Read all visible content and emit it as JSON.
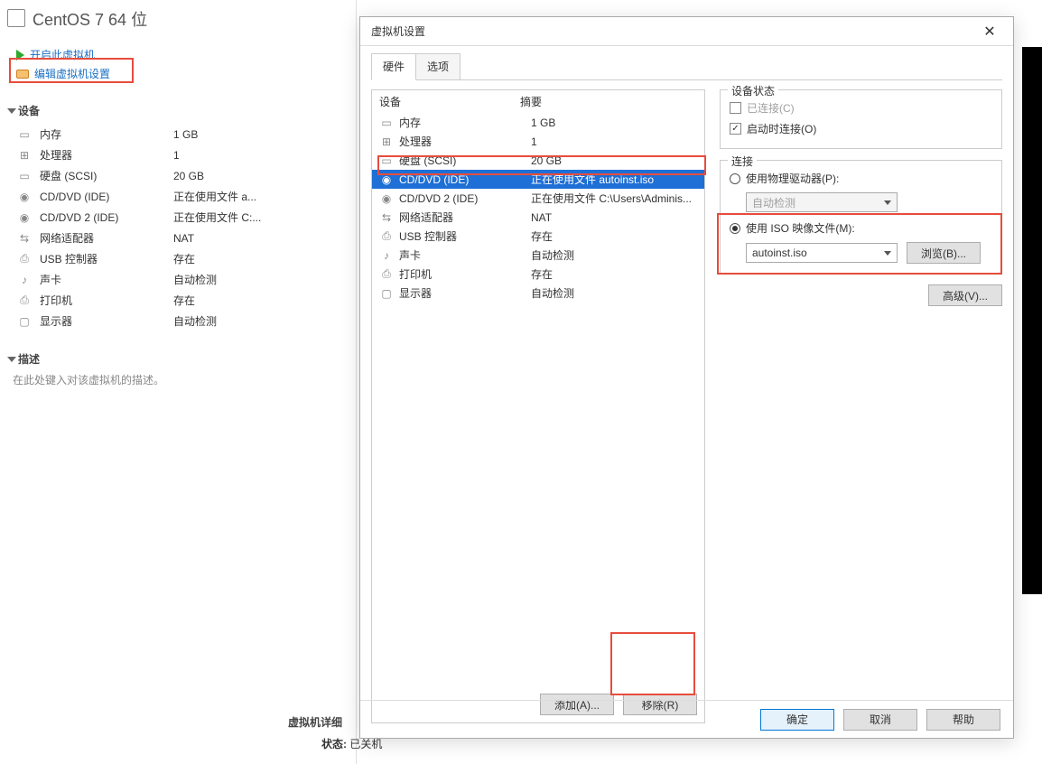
{
  "vm": {
    "title": "CentOS 7 64 位",
    "power_on": "开启此虚拟机",
    "edit_settings": "编辑虚拟机设置",
    "devices_hdr": "设备",
    "devices": [
      {
        "name": "内存",
        "value": "1 GB"
      },
      {
        "name": "处理器",
        "value": "1"
      },
      {
        "name": "硬盘 (SCSI)",
        "value": "20 GB"
      },
      {
        "name": "CD/DVD (IDE)",
        "value": "正在使用文件 a..."
      },
      {
        "name": "CD/DVD 2 (IDE)",
        "value": "正在使用文件 C:..."
      },
      {
        "name": "网络适配器",
        "value": "NAT"
      },
      {
        "name": "USB 控制器",
        "value": "存在"
      },
      {
        "name": "声卡",
        "value": "自动检测"
      },
      {
        "name": "打印机",
        "value": "存在"
      },
      {
        "name": "显示器",
        "value": "自动检测"
      }
    ],
    "desc_hdr": "描述",
    "desc_placeholder": "在此处键入对该虚拟机的描述。",
    "details_hdr": "虚拟机详细",
    "status_label": "状态:",
    "status_value": "已关机"
  },
  "dialog": {
    "title": "虚拟机设置",
    "tabs": {
      "hardware": "硬件",
      "options": "选项"
    },
    "hw_cols": {
      "device": "设备",
      "summary": "摘要"
    },
    "hw": [
      {
        "name": "内存",
        "summary": "1 GB",
        "icon": "i-mem"
      },
      {
        "name": "处理器",
        "summary": "1",
        "icon": "i-cpu"
      },
      {
        "name": "硬盘 (SCSI)",
        "summary": "20 GB",
        "icon": "i-disk"
      },
      {
        "name": "CD/DVD (IDE)",
        "summary": "正在使用文件 autoinst.iso",
        "icon": "i-cd",
        "selected": true
      },
      {
        "name": "CD/DVD 2 (IDE)",
        "summary": "正在使用文件 C:\\Users\\Adminis...",
        "icon": "i-cd"
      },
      {
        "name": "网络适配器",
        "summary": "NAT",
        "icon": "i-net"
      },
      {
        "name": "USB 控制器",
        "summary": "存在",
        "icon": "i-usb"
      },
      {
        "name": "声卡",
        "summary": "自动检测",
        "icon": "i-snd"
      },
      {
        "name": "打印机",
        "summary": "存在",
        "icon": "i-prn"
      },
      {
        "name": "显示器",
        "summary": "自动检测",
        "icon": "i-dsp"
      }
    ],
    "add": "添加(A)...",
    "remove": "移除(R)",
    "state_group": "设备状态",
    "connected": "已连接(C)",
    "connect_start": "启动时连接(O)",
    "conn_group": "连接",
    "use_physical": "使用物理驱动器(P):",
    "auto_detect": "自动检测",
    "use_iso": "使用 ISO 映像文件(M):",
    "iso_value": "autoinst.iso",
    "browse": "浏览(B)...",
    "advanced": "高级(V)...",
    "ok": "确定",
    "cancel": "取消",
    "help": "帮助"
  }
}
